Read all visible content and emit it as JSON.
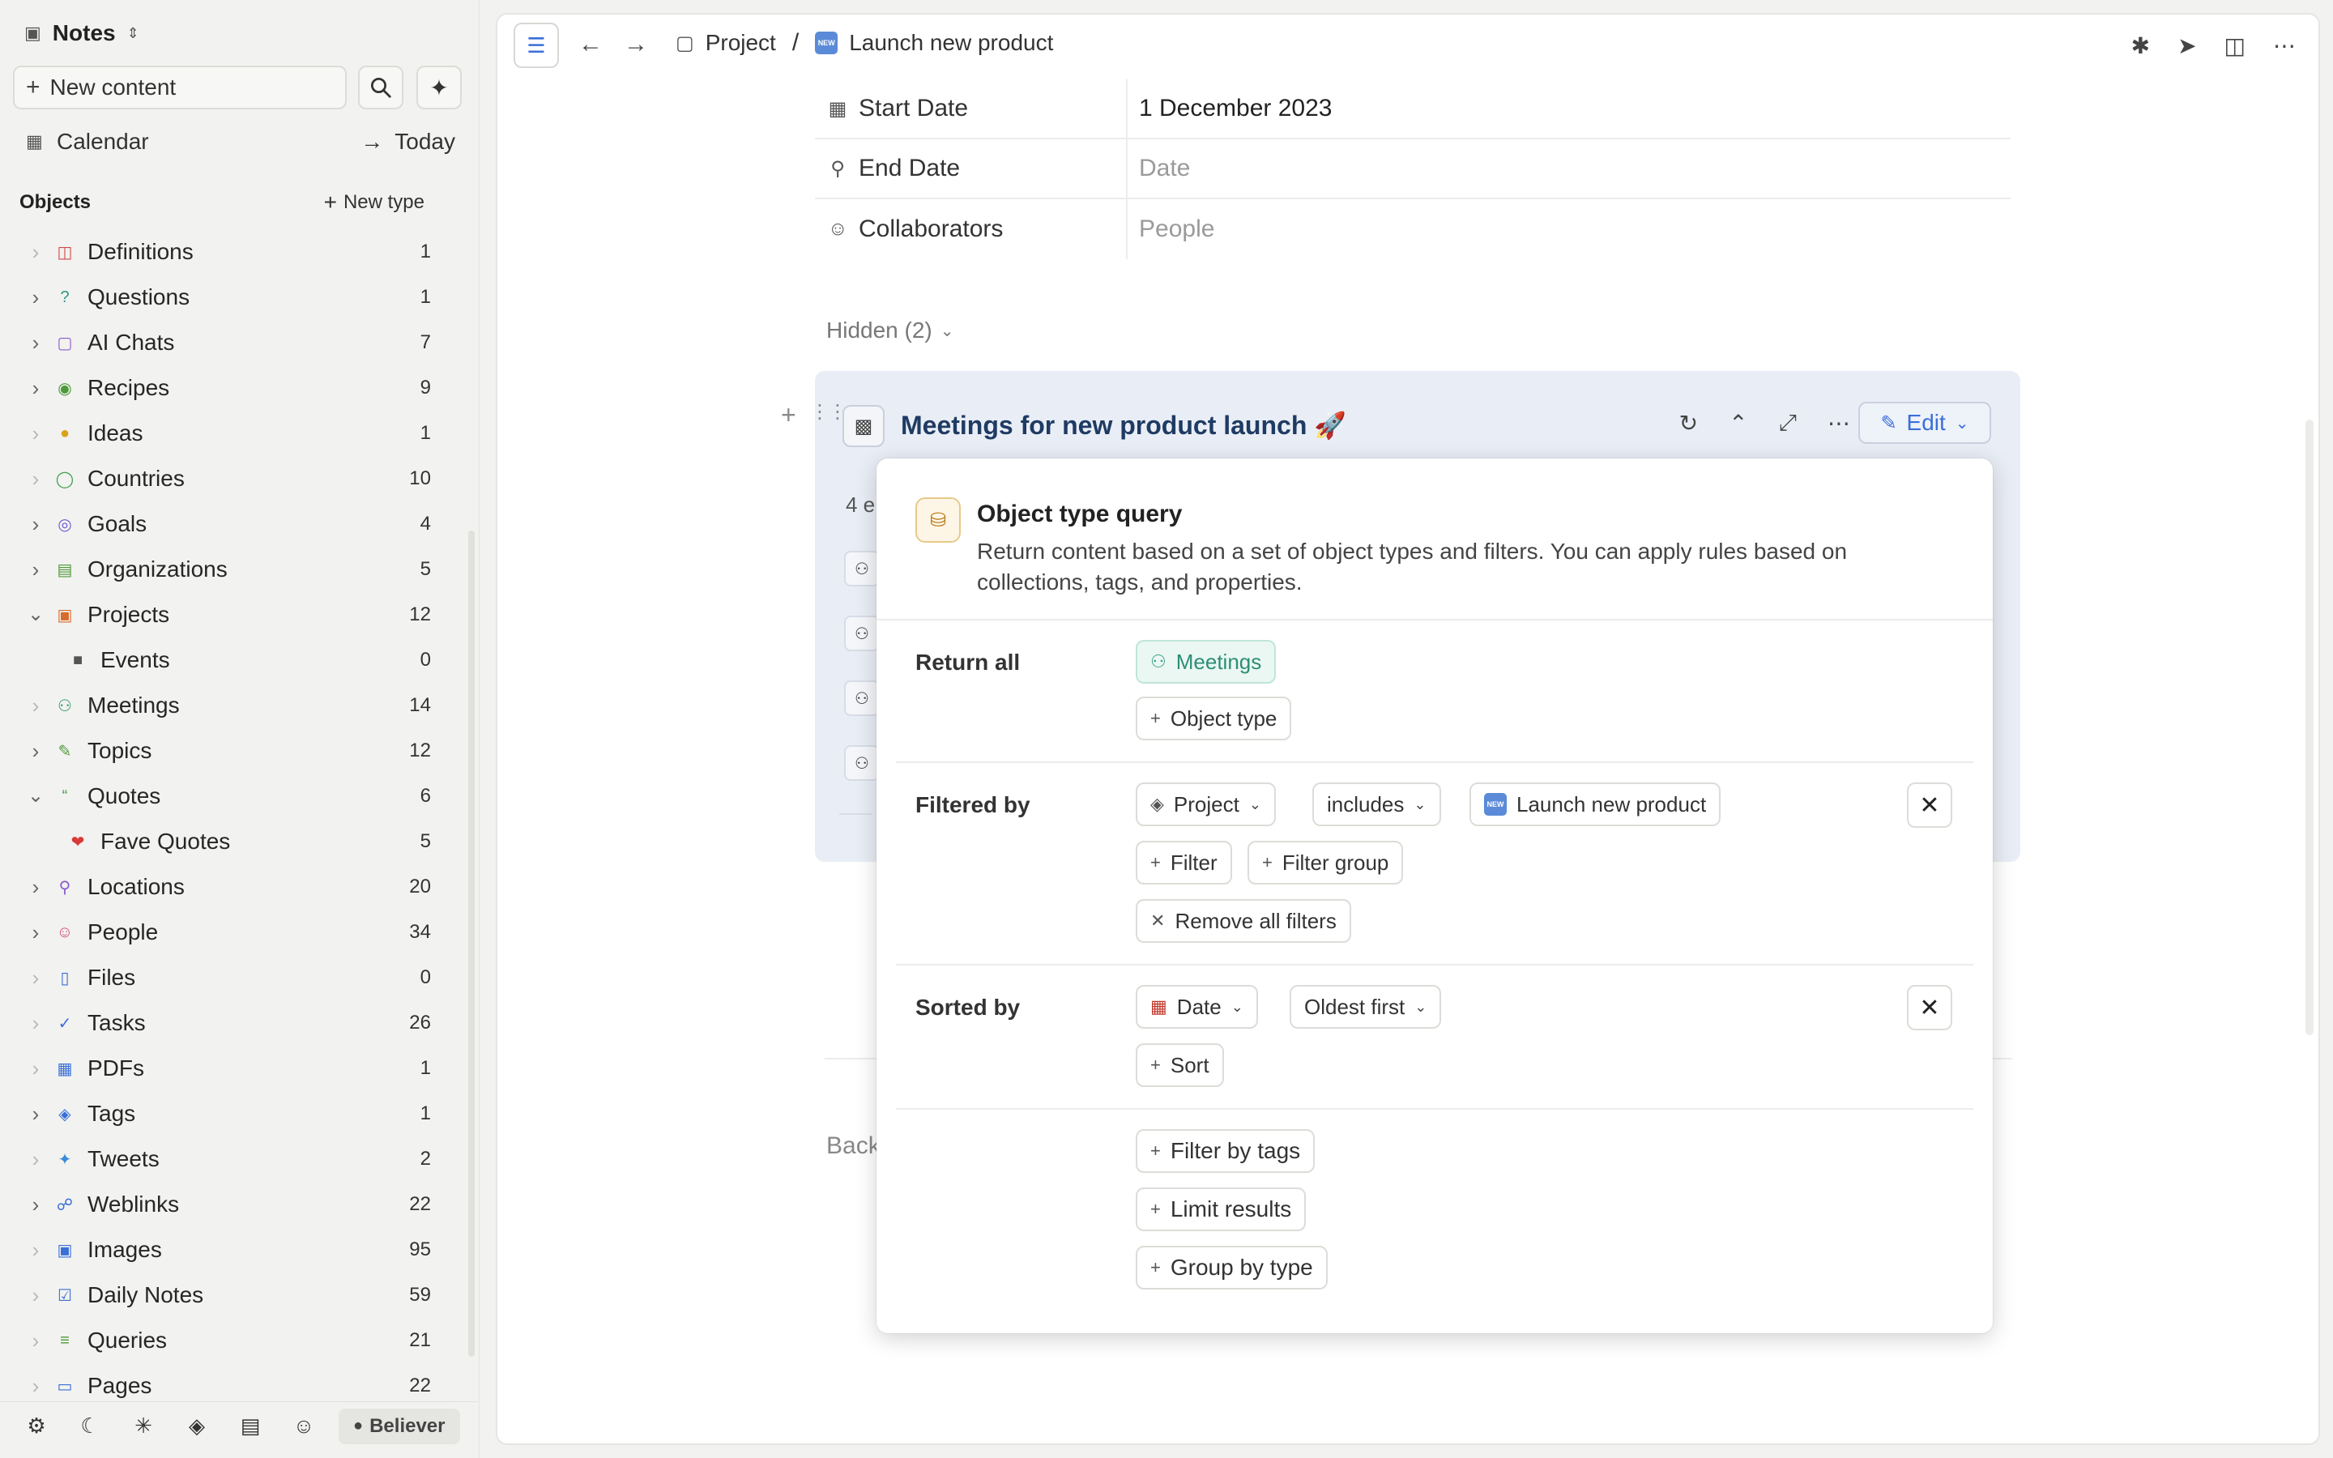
{
  "workspace": {
    "name": "Notes"
  },
  "sidebar": {
    "new_content_label": "New content",
    "calendar_label": "Calendar",
    "today_label": "Today",
    "objects_header": "Objects",
    "new_type_label": "New type",
    "items": [
      {
        "label": "Definitions",
        "count": "1",
        "icon": "book-icon",
        "color": "#d04b4b",
        "chev": "dim"
      },
      {
        "label": "Questions",
        "count": "1",
        "icon": "question-icon",
        "color": "#2f9a86",
        "chev": "dark"
      },
      {
        "label": "AI Chats",
        "count": "7",
        "icon": "chat-icon",
        "color": "#8a5bd0",
        "chev": "dark"
      },
      {
        "label": "Recipes",
        "count": "9",
        "icon": "recipe-icon",
        "color": "#4d9a3a",
        "chev": "dark"
      },
      {
        "label": "Ideas",
        "count": "1",
        "icon": "lightbulb-icon",
        "color": "#d8a31c",
        "chev": "dim"
      },
      {
        "label": "Countries",
        "count": "10",
        "icon": "globe-icon",
        "color": "#3fa04a",
        "chev": "dim"
      },
      {
        "label": "Goals",
        "count": "4",
        "icon": "target-icon",
        "color": "#6b5bd8",
        "chev": "dark"
      },
      {
        "label": "Organizations",
        "count": "5",
        "icon": "building-icon",
        "color": "#4f9a3a",
        "chev": "dark"
      },
      {
        "label": "Projects",
        "count": "12",
        "icon": "cube-icon",
        "color": "#d86a2a",
        "chev": "open"
      },
      {
        "label": "Events",
        "count": "0",
        "icon": "lock-icon",
        "color": "#555555",
        "chev": "none",
        "child": true
      },
      {
        "label": "Meetings",
        "count": "14",
        "icon": "people-icon",
        "color": "#2f9a6a",
        "chev": "dim"
      },
      {
        "label": "Topics",
        "count": "12",
        "icon": "pencil-square-icon",
        "color": "#4d9a3a",
        "chev": "dark"
      },
      {
        "label": "Quotes",
        "count": "6",
        "icon": "quote-icon",
        "color": "#3fa04a",
        "chev": "open"
      },
      {
        "label": "Fave Quotes",
        "count": "5",
        "icon": "heart-icon",
        "color": "#d83a3a",
        "chev": "none",
        "child": true
      },
      {
        "label": "Locations",
        "count": "20",
        "icon": "pin-icon",
        "color": "#8a5bd0",
        "chev": "dark"
      },
      {
        "label": "People",
        "count": "34",
        "icon": "person-icon",
        "color": "#d04b7a",
        "chev": "dark"
      },
      {
        "label": "Files",
        "count": "0",
        "icon": "file-icon",
        "color": "#3a6fd8",
        "chev": "dim"
      },
      {
        "label": "Tasks",
        "count": "26",
        "icon": "task-icon",
        "color": "#3a6fd8",
        "chev": "dim"
      },
      {
        "label": "PDFs",
        "count": "1",
        "icon": "pdf-icon",
        "color": "#3a6fd8",
        "chev": "dim"
      },
      {
        "label": "Tags",
        "count": "1",
        "icon": "tag-icon",
        "color": "#3a6fd8",
        "chev": "dark"
      },
      {
        "label": "Tweets",
        "count": "2",
        "icon": "bird-icon",
        "color": "#3a8ad8",
        "chev": "dim"
      },
      {
        "label": "Weblinks",
        "count": "22",
        "icon": "link-globe-icon",
        "color": "#3a6fd8",
        "chev": "dark"
      },
      {
        "label": "Images",
        "count": "95",
        "icon": "image-icon",
        "color": "#3a6fd8",
        "chev": "dim"
      },
      {
        "label": "Daily Notes",
        "count": "59",
        "icon": "calendar-check-icon",
        "color": "#3a6fd8",
        "chev": "dim"
      },
      {
        "label": "Queries",
        "count": "21",
        "icon": "query-icon",
        "color": "#4d9a3a",
        "chev": "dim"
      },
      {
        "label": "Pages",
        "count": "22",
        "icon": "page-icon",
        "color": "#3a6fd8",
        "chev": "dim"
      }
    ],
    "footer_badge": "Believer"
  },
  "breadcrumb": {
    "parent": "Project",
    "sep": "/",
    "current": "Launch new product",
    "badge": "NEW"
  },
  "properties": [
    {
      "label": "Start Date",
      "value": "1 December 2023",
      "placeholder": false,
      "icon": "calendar-icon"
    },
    {
      "label": "End Date",
      "value": "Date",
      "placeholder": true,
      "icon": "pin-icon"
    },
    {
      "label": "Collaborators",
      "value": "People",
      "placeholder": true,
      "icon": "person-icon"
    }
  ],
  "hidden_toggle": "Hidden (2)",
  "query_block": {
    "title": "Meetings for new product launch 🚀",
    "edit_label": "Edit",
    "count_text": "4 e"
  },
  "back_text": "Back",
  "popup": {
    "title": "Object type query",
    "description": "Return content based on a set of object types and filters. You can apply rules based on collections, tags, and properties.",
    "return_all_label": "Return all",
    "object_type_chip": "Meetings",
    "add_object_type": "Object type",
    "filtered_by_label": "Filtered by",
    "filter_property": "Project",
    "filter_operator": "includes",
    "filter_value": "Launch new product",
    "add_filter": "Filter",
    "add_filter_group": "Filter group",
    "remove_all_filters": "Remove all filters",
    "sorted_by_label": "Sorted by",
    "sort_property": "Date",
    "sort_order": "Oldest first",
    "add_sort": "Sort",
    "filter_by_tags": "Filter by tags",
    "limit_results": "Limit results",
    "group_by_type": "Group by type"
  },
  "colors": {
    "accent": "#3a6fd8",
    "title": "#1f3b63",
    "query_bg": "#e9eef6",
    "meetings_chip": "#eaf7f3"
  }
}
